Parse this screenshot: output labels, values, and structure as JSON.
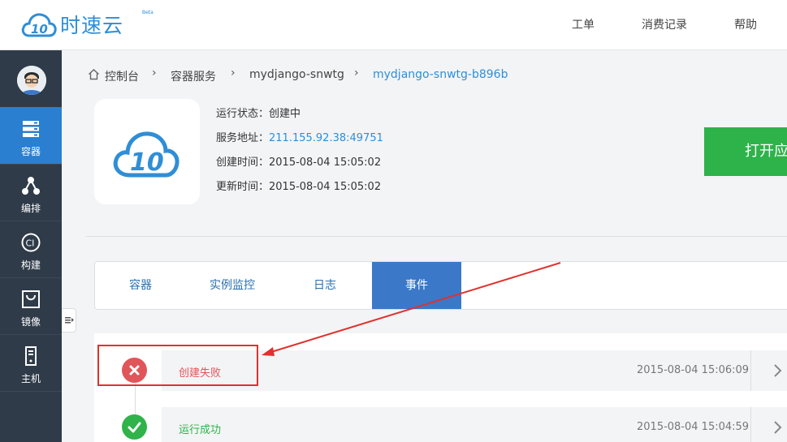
{
  "header": {
    "logo_text": "时速云",
    "logo_badge": "Beta",
    "nav": [
      "工单",
      "消费记录",
      "帮助"
    ]
  },
  "sidebar": {
    "items": [
      {
        "label": "容器",
        "icon": "server-icon",
        "active": true
      },
      {
        "label": "编排",
        "icon": "topology-icon",
        "active": false
      },
      {
        "label": "构建",
        "icon": "ci-icon",
        "active": false
      },
      {
        "label": "镜像",
        "icon": "bag-icon",
        "active": false
      },
      {
        "label": "主机",
        "icon": "host-icon",
        "active": false
      }
    ]
  },
  "breadcrumb": {
    "items": [
      "控制台",
      "容器服务",
      "mydjango-snwtg",
      "mydjango-snwtg-b896b"
    ]
  },
  "app": {
    "status_label": "运行状态：",
    "status_value": "创建中",
    "address_label": "服务地址：",
    "address_value": "211.155.92.38:49751",
    "created_label": "创建时间：",
    "created_value": "2015-08-04 15:05:02",
    "updated_label": "更新时间：",
    "updated_value": "2015-08-04 15:05:02",
    "open_button": "打开应用"
  },
  "tabs": {
    "items": [
      "容器",
      "实例监控",
      "日志",
      "事件"
    ],
    "active": "事件"
  },
  "events": [
    {
      "title": "创建失败",
      "time": "2015-08-04 15:06:09",
      "status": "error"
    },
    {
      "title": "运行成功",
      "time": "2015-08-04 15:04:59",
      "status": "success"
    }
  ],
  "colors": {
    "brand_blue": "#2f8ed6",
    "sidebar_bg": "#2f3b49",
    "sidebar_active": "#2a7fd0",
    "tab_active": "#3b78c8",
    "open_button": "#2db34a",
    "error": "#e0555a",
    "success": "#2fb34a",
    "annotation_red": "#e0312e"
  }
}
